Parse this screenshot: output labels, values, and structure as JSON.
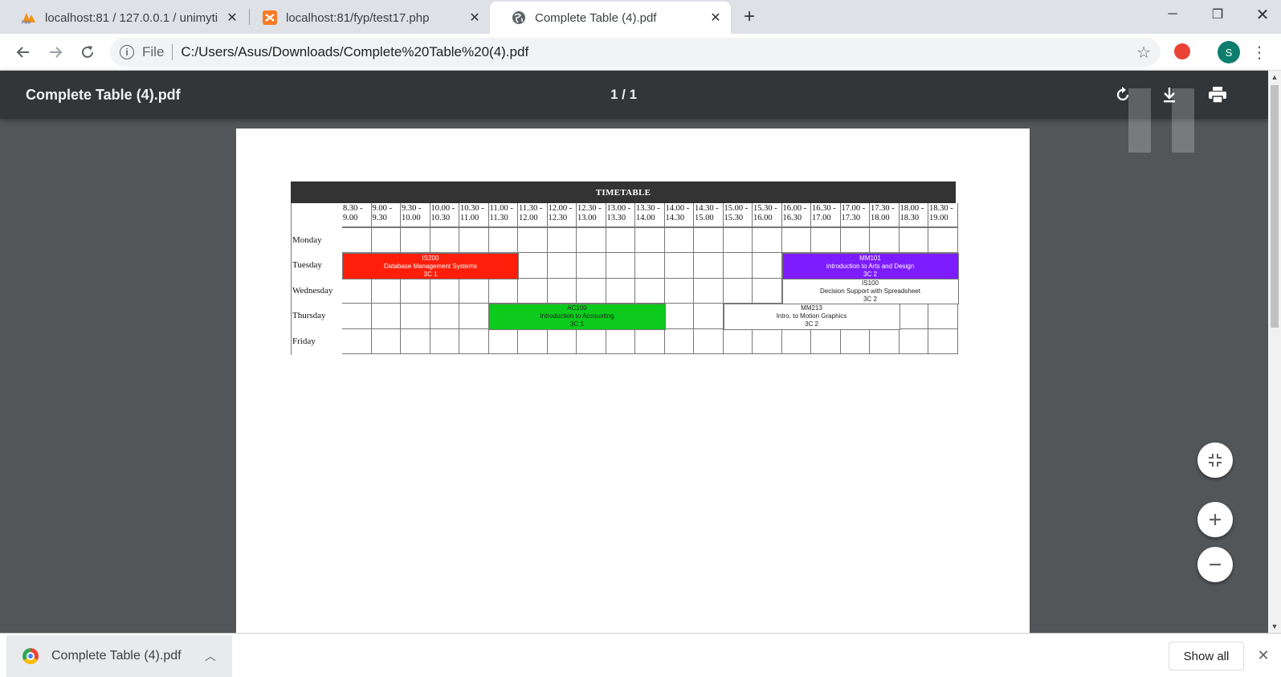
{
  "tabs": [
    {
      "title": "localhost:81 / 127.0.0.1 / unimyti",
      "icon": "phpmyadmin-icon"
    },
    {
      "title": "localhost:81/fyp/test17.php",
      "icon": "xampp-icon"
    },
    {
      "title": "Complete Table (4).pdf",
      "icon": "globe-icon"
    }
  ],
  "address": {
    "scheme_label": "File",
    "url": "C:/Users/Asus/Downloads/Complete%20Table%20(4).pdf"
  },
  "profile_initial": "S",
  "pdf": {
    "title": "Complete Table (4).pdf",
    "page_indicator": "1 / 1"
  },
  "timetable": {
    "heading": "TIMETABLE",
    "times": [
      "8.30 -\n9.00",
      "9.00 -\n9.30",
      "9.30 -\n10.00",
      "10.00 -\n10.30",
      "10.30 -\n11.00",
      "11.00 -\n11.30",
      "11.30 -\n12.00",
      "12.00 -\n12.30",
      "12.30 -\n13.00",
      "13.00 -\n13.30",
      "13.30 -\n14.00",
      "14.00 -\n14.30",
      "14.30 -\n15.00",
      "15.00 -\n15.30",
      "15.30 -\n16.00",
      "16.00 -\n16.30",
      "16.30 -\n17.00",
      "17.00 -\n17.30",
      "17.30 -\n18.00",
      "18.00 -\n18.30",
      "18.30 -\n19.00"
    ],
    "days": [
      "Monday",
      "Tuesday",
      "Wednesday",
      "Thursday",
      "Friday"
    ],
    "classes": [
      {
        "day": 1,
        "start": 0,
        "span": 6,
        "color": "#ff1e0a",
        "code": "IS200",
        "name": "Database Management Systems",
        "room": "3C 1"
      },
      {
        "day": 1,
        "start": 15,
        "span": 6,
        "color": "#7d1cff",
        "code": "MM101",
        "name": "Introduction to Arts and Design",
        "room": "3C 2"
      },
      {
        "day": 2,
        "start": 15,
        "span": 6,
        "color": "#ffffff",
        "code": "IS100",
        "name": "Decision Support with Spreadsheet",
        "room": "3C 2"
      },
      {
        "day": 3,
        "start": 5,
        "span": 6,
        "color": "#0ccb1c",
        "code": "AC100",
        "name": "Introduction to Accounting",
        "room": "3C 1"
      },
      {
        "day": 3,
        "start": 13,
        "span": 6,
        "color": "#ffffff",
        "code": "MM213",
        "name": "Intro. to Motion Graphics",
        "room": "3C 2"
      }
    ]
  },
  "downloads": {
    "file": "Complete Table (4).pdf",
    "show_all": "Show all"
  }
}
